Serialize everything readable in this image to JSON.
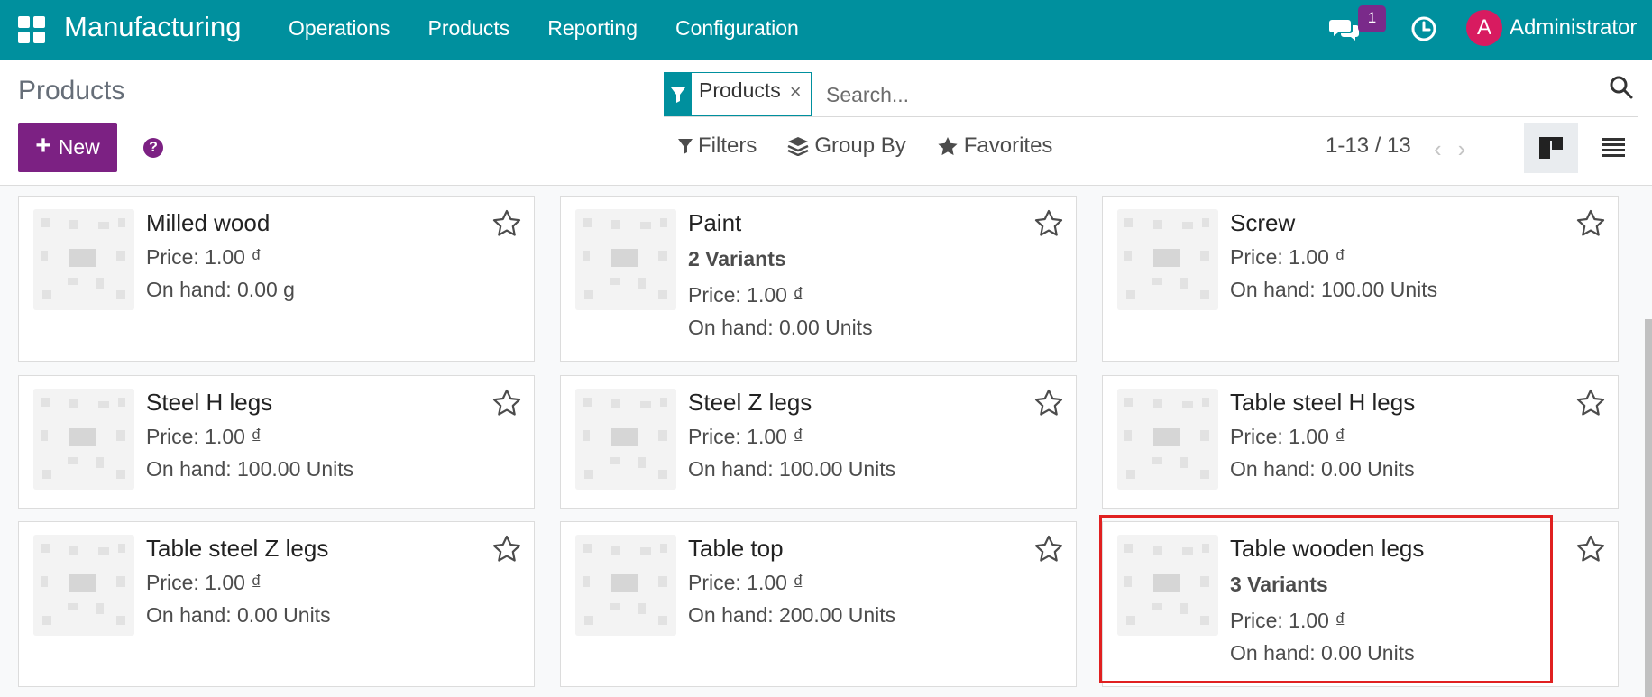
{
  "navbar": {
    "app_name": "Manufacturing",
    "menu": [
      "Operations",
      "Products",
      "Reporting",
      "Configuration"
    ],
    "chat_badge": "1",
    "avatar_initial": "A",
    "user_name": "Administrator",
    "color": "#00909e"
  },
  "control_panel": {
    "title": "Products",
    "new_label": "New",
    "help_label": "?",
    "search": {
      "facet_label": "Products",
      "facet_close": "×",
      "placeholder": "Search..."
    },
    "filters_label": "Filters",
    "group_by_label": "Group By",
    "favorites_label": "Favorites",
    "pager": "1-13 / 13",
    "pager_prev": "‹",
    "pager_next": "›"
  },
  "cards": [
    {
      "name": "Milled wood",
      "variants": "",
      "price": "Price: 1.00 ₫",
      "on_hand": "On hand: 0.00 g"
    },
    {
      "name": "Paint",
      "variants": "2 Variants",
      "price": "Price: 1.00 ₫",
      "on_hand": "On hand: 0.00 Units"
    },
    {
      "name": "Screw",
      "variants": "",
      "price": "Price: 1.00 ₫",
      "on_hand": "On hand: 100.00 Units"
    },
    {
      "name": "Steel H legs",
      "variants": "",
      "price": "Price: 1.00 ₫",
      "on_hand": "On hand: 100.00 Units"
    },
    {
      "name": "Steel Z legs",
      "variants": "",
      "price": "Price: 1.00 ₫",
      "on_hand": "On hand: 100.00 Units"
    },
    {
      "name": "Table steel H legs",
      "variants": "",
      "price": "Price: 1.00 ₫",
      "on_hand": "On hand: 0.00 Units"
    },
    {
      "name": "Table steel Z legs",
      "variants": "",
      "price": "Price: 1.00 ₫",
      "on_hand": "On hand: 0.00 Units"
    },
    {
      "name": "Table top",
      "variants": "",
      "price": "Price: 1.00 ₫",
      "on_hand": "On hand: 200.00 Units"
    },
    {
      "name": "Table wooden legs",
      "variants": "3 Variants",
      "price": "Price: 1.00 ₫",
      "on_hand": "On hand: 0.00 Units"
    }
  ],
  "colors": {
    "primary": "#7c2183",
    "highlight": "#e02020"
  }
}
